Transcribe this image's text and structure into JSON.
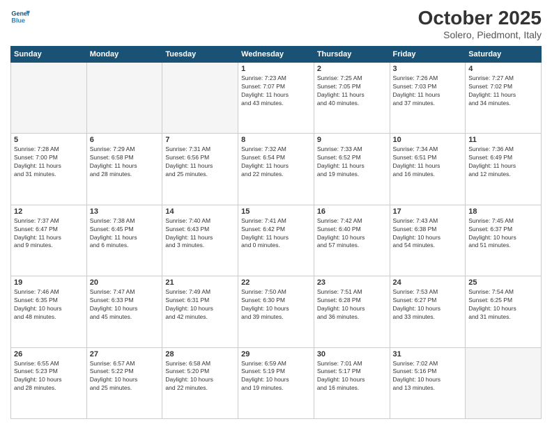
{
  "header": {
    "logo_line1": "General",
    "logo_line2": "Blue",
    "month": "October 2025",
    "location": "Solero, Piedmont, Italy"
  },
  "days_of_week": [
    "Sunday",
    "Monday",
    "Tuesday",
    "Wednesday",
    "Thursday",
    "Friday",
    "Saturday"
  ],
  "weeks": [
    [
      {
        "day": "",
        "info": ""
      },
      {
        "day": "",
        "info": ""
      },
      {
        "day": "",
        "info": ""
      },
      {
        "day": "1",
        "info": "Sunrise: 7:23 AM\nSunset: 7:07 PM\nDaylight: 11 hours\nand 43 minutes."
      },
      {
        "day": "2",
        "info": "Sunrise: 7:25 AM\nSunset: 7:05 PM\nDaylight: 11 hours\nand 40 minutes."
      },
      {
        "day": "3",
        "info": "Sunrise: 7:26 AM\nSunset: 7:03 PM\nDaylight: 11 hours\nand 37 minutes."
      },
      {
        "day": "4",
        "info": "Sunrise: 7:27 AM\nSunset: 7:02 PM\nDaylight: 11 hours\nand 34 minutes."
      }
    ],
    [
      {
        "day": "5",
        "info": "Sunrise: 7:28 AM\nSunset: 7:00 PM\nDaylight: 11 hours\nand 31 minutes."
      },
      {
        "day": "6",
        "info": "Sunrise: 7:29 AM\nSunset: 6:58 PM\nDaylight: 11 hours\nand 28 minutes."
      },
      {
        "day": "7",
        "info": "Sunrise: 7:31 AM\nSunset: 6:56 PM\nDaylight: 11 hours\nand 25 minutes."
      },
      {
        "day": "8",
        "info": "Sunrise: 7:32 AM\nSunset: 6:54 PM\nDaylight: 11 hours\nand 22 minutes."
      },
      {
        "day": "9",
        "info": "Sunrise: 7:33 AM\nSunset: 6:52 PM\nDaylight: 11 hours\nand 19 minutes."
      },
      {
        "day": "10",
        "info": "Sunrise: 7:34 AM\nSunset: 6:51 PM\nDaylight: 11 hours\nand 16 minutes."
      },
      {
        "day": "11",
        "info": "Sunrise: 7:36 AM\nSunset: 6:49 PM\nDaylight: 11 hours\nand 12 minutes."
      }
    ],
    [
      {
        "day": "12",
        "info": "Sunrise: 7:37 AM\nSunset: 6:47 PM\nDaylight: 11 hours\nand 9 minutes."
      },
      {
        "day": "13",
        "info": "Sunrise: 7:38 AM\nSunset: 6:45 PM\nDaylight: 11 hours\nand 6 minutes."
      },
      {
        "day": "14",
        "info": "Sunrise: 7:40 AM\nSunset: 6:43 PM\nDaylight: 11 hours\nand 3 minutes."
      },
      {
        "day": "15",
        "info": "Sunrise: 7:41 AM\nSunset: 6:42 PM\nDaylight: 11 hours\nand 0 minutes."
      },
      {
        "day": "16",
        "info": "Sunrise: 7:42 AM\nSunset: 6:40 PM\nDaylight: 10 hours\nand 57 minutes."
      },
      {
        "day": "17",
        "info": "Sunrise: 7:43 AM\nSunset: 6:38 PM\nDaylight: 10 hours\nand 54 minutes."
      },
      {
        "day": "18",
        "info": "Sunrise: 7:45 AM\nSunset: 6:37 PM\nDaylight: 10 hours\nand 51 minutes."
      }
    ],
    [
      {
        "day": "19",
        "info": "Sunrise: 7:46 AM\nSunset: 6:35 PM\nDaylight: 10 hours\nand 48 minutes."
      },
      {
        "day": "20",
        "info": "Sunrise: 7:47 AM\nSunset: 6:33 PM\nDaylight: 10 hours\nand 45 minutes."
      },
      {
        "day": "21",
        "info": "Sunrise: 7:49 AM\nSunset: 6:31 PM\nDaylight: 10 hours\nand 42 minutes."
      },
      {
        "day": "22",
        "info": "Sunrise: 7:50 AM\nSunset: 6:30 PM\nDaylight: 10 hours\nand 39 minutes."
      },
      {
        "day": "23",
        "info": "Sunrise: 7:51 AM\nSunset: 6:28 PM\nDaylight: 10 hours\nand 36 minutes."
      },
      {
        "day": "24",
        "info": "Sunrise: 7:53 AM\nSunset: 6:27 PM\nDaylight: 10 hours\nand 33 minutes."
      },
      {
        "day": "25",
        "info": "Sunrise: 7:54 AM\nSunset: 6:25 PM\nDaylight: 10 hours\nand 31 minutes."
      }
    ],
    [
      {
        "day": "26",
        "info": "Sunrise: 6:55 AM\nSunset: 5:23 PM\nDaylight: 10 hours\nand 28 minutes."
      },
      {
        "day": "27",
        "info": "Sunrise: 6:57 AM\nSunset: 5:22 PM\nDaylight: 10 hours\nand 25 minutes."
      },
      {
        "day": "28",
        "info": "Sunrise: 6:58 AM\nSunset: 5:20 PM\nDaylight: 10 hours\nand 22 minutes."
      },
      {
        "day": "29",
        "info": "Sunrise: 6:59 AM\nSunset: 5:19 PM\nDaylight: 10 hours\nand 19 minutes."
      },
      {
        "day": "30",
        "info": "Sunrise: 7:01 AM\nSunset: 5:17 PM\nDaylight: 10 hours\nand 16 minutes."
      },
      {
        "day": "31",
        "info": "Sunrise: 7:02 AM\nSunset: 5:16 PM\nDaylight: 10 hours\nand 13 minutes."
      },
      {
        "day": "",
        "info": ""
      }
    ]
  ]
}
